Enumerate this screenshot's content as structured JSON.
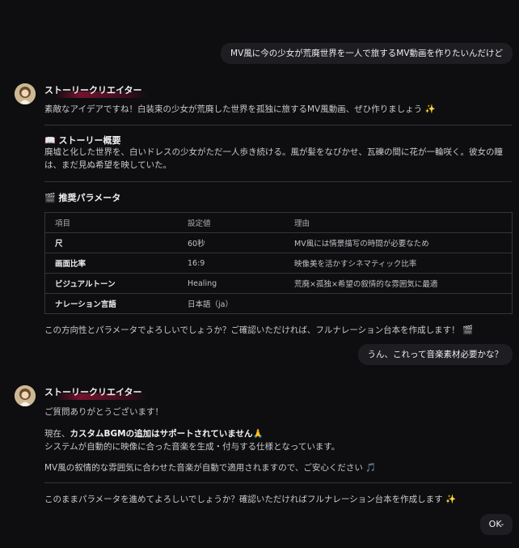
{
  "messages": {
    "user_1": "MV風に今の少女が荒廃世界を一人で旅するMV動画を作りたいんだけど",
    "assistant_1": {
      "name": "ストーリークリエイター",
      "intro": "素敵なアイデアですね！白装束の少女が荒廃した世界を孤独に旅するMV風動画、ぜひ作りましょう",
      "intro_emoji": "✨",
      "story_heading_emoji": "📖",
      "story_heading": "ストーリー概要",
      "story_line1": "廃墟と化した世界を、白いドレスの少女がただ一人歩き続ける。風が髪をなびかせ、瓦礫の間に花が一輪咲く。彼女の瞳",
      "story_line2": "は、まだ見ぬ希望を映していた。",
      "params_heading_emoji": "🎬",
      "params_heading": "推奨パラメータ",
      "table": {
        "headers": [
          "項目",
          "設定値",
          "理由"
        ],
        "rows": [
          [
            "尺",
            "60秒",
            "MV風には情景描写の時間が必要なため"
          ],
          [
            "画面比率",
            "16:9",
            "映像美を活かすシネマティック比率"
          ],
          [
            "ビジュアルトーン",
            "Healing",
            "荒廃×孤独×希望の叙情的な雰囲気に最適"
          ],
          [
            "ナレーション言語",
            "日本語（ja）",
            ""
          ]
        ]
      },
      "closing": "この方向性とパラメータでよろしいでしょうか？ご確認いただければ、フルナレーション台本を作成します！",
      "closing_emoji": "🎬"
    },
    "user_2": "うん、これって音楽素材必要かな？",
    "assistant_2": {
      "name": "ストーリークリエイター",
      "thanks": "ご質問ありがとうございます！",
      "line_a_prefix": "現在、",
      "line_a_strong": "カスタムBGMの追加はサポートされていません",
      "line_a_emoji": "🙏",
      "line_b": "システムが自動的に映像に合った音楽を生成・付与する仕様となっています。",
      "line_c": "MV風の叙情的な雰囲気に合わせた音楽が自動で適用されますので、ご安心ください",
      "line_c_emoji": "🎵",
      "closing": "このままパラメータを進めてよろしいでしょうか？確認いただければフルナレーション台本を作成します",
      "closing_emoji": "✨"
    },
    "user_3": "OK-"
  }
}
